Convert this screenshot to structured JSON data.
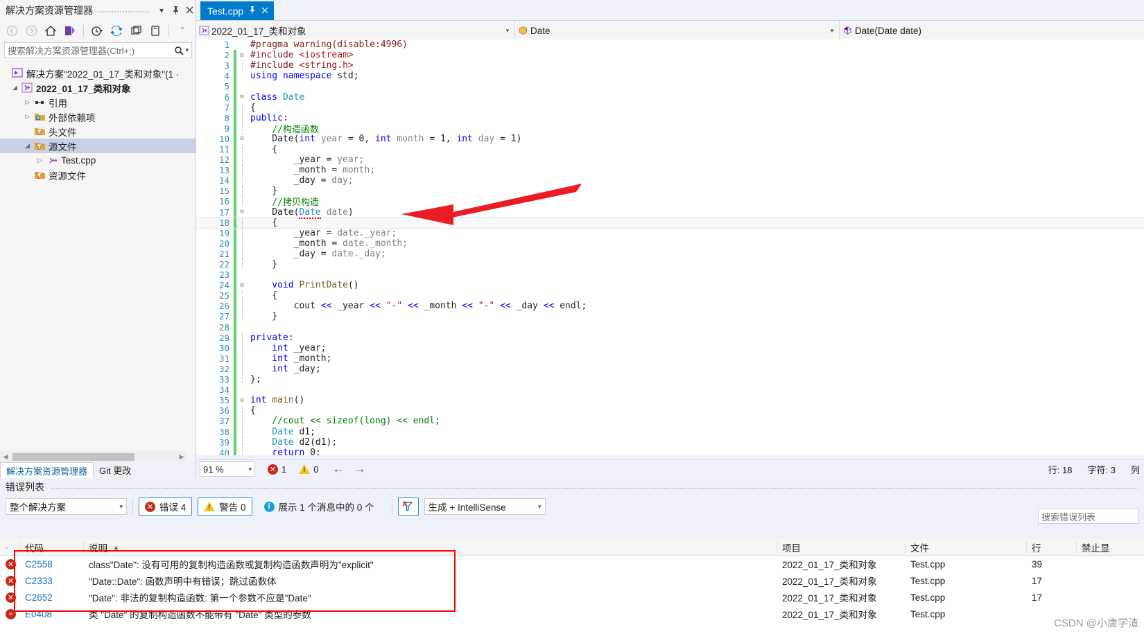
{
  "solution_explorer": {
    "title": "解决方案资源管理器",
    "header_buttons": [
      "chevron-down-icon",
      "pin-icon",
      "close-icon"
    ],
    "toolbar_icons": [
      "back-icon",
      "forward-icon",
      "home-icon",
      "sync-with-active-document-icon",
      "pending-changes-icon",
      "refresh-icon",
      "collapse-all-icon",
      "show-all-files-icon",
      "properties-icon"
    ],
    "search": {
      "placeholder": "搜索解决方案资源管理器(Ctrl+;)"
    },
    "tree": [
      {
        "label": "解决方案\"2022_01_17_类和对象\"(1 ·",
        "icon": "solution-icon",
        "indent": 0,
        "expander": "",
        "bold": false,
        "selected": false
      },
      {
        "label": "2022_01_17_类和对象",
        "icon": "cpp-project-icon",
        "indent": 1,
        "expander": "▲",
        "bold": true,
        "selected": false
      },
      {
        "label": "引用",
        "icon": "references-icon",
        "indent": 2,
        "expander": "▷",
        "bold": false,
        "selected": false
      },
      {
        "label": "外部依赖项",
        "icon": "external-dependencies-icon",
        "indent": 2,
        "expander": "▷",
        "bold": false,
        "selected": false
      },
      {
        "label": "头文件",
        "icon": "filter-folder-icon",
        "indent": 2,
        "expander": "",
        "bold": false,
        "selected": false
      },
      {
        "label": "源文件",
        "icon": "filter-folder-icon",
        "indent": 2,
        "expander": "▲",
        "bold": false,
        "selected": true
      },
      {
        "label": "Test.cpp",
        "icon": "cpp-file-icon",
        "indent": 3,
        "expander": "▷",
        "bold": false,
        "selected": false
      },
      {
        "label": "资源文件",
        "icon": "filter-folder-icon",
        "indent": 2,
        "expander": "",
        "bold": false,
        "selected": false
      }
    ],
    "bottom_tabs": [
      {
        "label": "解决方案资源管理器",
        "active": true
      },
      {
        "label": "Git 更改",
        "active": false
      }
    ]
  },
  "editor": {
    "tab": {
      "label": "Test.cpp",
      "pin": "pin-icon",
      "close": "close-icon"
    },
    "navbar": {
      "project": "2022_01_17_类和对象",
      "type": "Date",
      "member": "Date(Date date)"
    },
    "current_line": 18,
    "lines": [
      {
        "n": 1,
        "changed": false,
        "glyph": "",
        "tokens": [
          {
            "t": "#pragma warning(disable:4996)",
            "c": "pp"
          }
        ]
      },
      {
        "n": 2,
        "changed": true,
        "glyph": "-",
        "tokens": [
          {
            "t": "#include ",
            "c": "pp"
          },
          {
            "t": "<iostream>",
            "c": "str"
          }
        ]
      },
      {
        "n": 3,
        "changed": true,
        "glyph": "|",
        "tokens": [
          {
            "t": "#include ",
            "c": "pp"
          },
          {
            "t": "<string.h>",
            "c": "str"
          }
        ]
      },
      {
        "n": 4,
        "changed": true,
        "glyph": "",
        "tokens": [
          {
            "t": "using namespace ",
            "c": "k"
          },
          {
            "t": "std;",
            "c": "pl"
          }
        ]
      },
      {
        "n": 5,
        "changed": true,
        "glyph": "",
        "tokens": []
      },
      {
        "n": 6,
        "changed": true,
        "glyph": "-",
        "tokens": [
          {
            "t": "class ",
            "c": "k"
          },
          {
            "t": "Date",
            "c": "ty"
          }
        ]
      },
      {
        "n": 7,
        "changed": true,
        "glyph": "|",
        "tokens": [
          {
            "t": "{",
            "c": "pl"
          }
        ]
      },
      {
        "n": 8,
        "changed": true,
        "glyph": "|",
        "tokens": [
          {
            "t": "public",
            "c": "k"
          },
          {
            "t": ":",
            "c": "pl"
          }
        ]
      },
      {
        "n": 9,
        "changed": true,
        "glyph": "|",
        "tokens": [
          {
            "t": "    //构造函数",
            "c": "cm"
          }
        ]
      },
      {
        "n": 10,
        "changed": true,
        "glyph": "-",
        "tokens": [
          {
            "t": "    Date(",
            "c": "pl"
          },
          {
            "t": "int ",
            "c": "k"
          },
          {
            "t": "year",
            "c": "var"
          },
          {
            "t": " = 0, ",
            "c": "pl"
          },
          {
            "t": "int ",
            "c": "k"
          },
          {
            "t": "month",
            "c": "var"
          },
          {
            "t": " = 1, ",
            "c": "pl"
          },
          {
            "t": "int ",
            "c": "k"
          },
          {
            "t": "day",
            "c": "var"
          },
          {
            "t": " = 1)",
            "c": "pl"
          }
        ]
      },
      {
        "n": 11,
        "changed": true,
        "glyph": "|",
        "tokens": [
          {
            "t": "    {",
            "c": "pl"
          }
        ]
      },
      {
        "n": 12,
        "changed": true,
        "glyph": "|",
        "tokens": [
          {
            "t": "        _year = ",
            "c": "pl"
          },
          {
            "t": "year;",
            "c": "var"
          }
        ]
      },
      {
        "n": 13,
        "changed": true,
        "glyph": "|",
        "tokens": [
          {
            "t": "        _month = ",
            "c": "pl"
          },
          {
            "t": "month;",
            "c": "var"
          }
        ]
      },
      {
        "n": 14,
        "changed": true,
        "glyph": "|",
        "tokens": [
          {
            "t": "        _day = ",
            "c": "pl"
          },
          {
            "t": "day;",
            "c": "var"
          }
        ]
      },
      {
        "n": 15,
        "changed": true,
        "glyph": "|",
        "tokens": [
          {
            "t": "    }",
            "c": "pl"
          }
        ]
      },
      {
        "n": 16,
        "changed": true,
        "glyph": "|",
        "tokens": [
          {
            "t": "    //拷贝构造",
            "c": "cm"
          }
        ]
      },
      {
        "n": 17,
        "changed": true,
        "glyph": "-",
        "tokens": [
          {
            "t": "    Date(",
            "c": "pl"
          },
          {
            "t": "Date",
            "c": "ty squig"
          },
          {
            "t": " ",
            "c": "pl"
          },
          {
            "t": "date",
            "c": "var"
          },
          {
            "t": ")",
            "c": "pl"
          }
        ]
      },
      {
        "n": 18,
        "changed": true,
        "glyph": "|",
        "tokens": [
          {
            "t": "    {",
            "c": "pl"
          }
        ]
      },
      {
        "n": 19,
        "changed": true,
        "glyph": "|",
        "tokens": [
          {
            "t": "        _year = ",
            "c": "pl"
          },
          {
            "t": "date._year;",
            "c": "var"
          }
        ]
      },
      {
        "n": 20,
        "changed": true,
        "glyph": "|",
        "tokens": [
          {
            "t": "        _month = ",
            "c": "pl"
          },
          {
            "t": "date._month;",
            "c": "var"
          }
        ]
      },
      {
        "n": 21,
        "changed": true,
        "glyph": "|",
        "tokens": [
          {
            "t": "        _day = ",
            "c": "pl"
          },
          {
            "t": "date._day;",
            "c": "var"
          }
        ]
      },
      {
        "n": 22,
        "changed": true,
        "glyph": "|",
        "tokens": [
          {
            "t": "    }",
            "c": "pl"
          }
        ]
      },
      {
        "n": 23,
        "changed": true,
        "glyph": "",
        "tokens": []
      },
      {
        "n": 24,
        "changed": true,
        "glyph": "-",
        "tokens": [
          {
            "t": "    void ",
            "c": "k"
          },
          {
            "t": "PrintDate",
            "c": "fn"
          },
          {
            "t": "()",
            "c": "pl"
          }
        ]
      },
      {
        "n": 25,
        "changed": true,
        "glyph": "|",
        "tokens": [
          {
            "t": "    {",
            "c": "pl"
          }
        ]
      },
      {
        "n": 26,
        "changed": true,
        "glyph": "|",
        "tokens": [
          {
            "t": "        cout ",
            "c": "pl"
          },
          {
            "t": "<< ",
            "c": "k"
          },
          {
            "t": "_year ",
            "c": "pl"
          },
          {
            "t": "<< ",
            "c": "k"
          },
          {
            "t": "\"-\" ",
            "c": "str"
          },
          {
            "t": "<< ",
            "c": "k"
          },
          {
            "t": "_month ",
            "c": "pl"
          },
          {
            "t": "<< ",
            "c": "k"
          },
          {
            "t": "\"-\" ",
            "c": "str"
          },
          {
            "t": "<< ",
            "c": "k"
          },
          {
            "t": "_day ",
            "c": "pl"
          },
          {
            "t": "<< ",
            "c": "k"
          },
          {
            "t": "endl;",
            "c": "pl"
          }
        ]
      },
      {
        "n": 27,
        "changed": true,
        "glyph": "|",
        "tokens": [
          {
            "t": "    }",
            "c": "pl"
          }
        ]
      },
      {
        "n": 28,
        "changed": true,
        "glyph": "",
        "tokens": []
      },
      {
        "n": 29,
        "changed": true,
        "glyph": "|",
        "tokens": [
          {
            "t": "private",
            "c": "k"
          },
          {
            "t": ":",
            "c": "pl"
          }
        ]
      },
      {
        "n": 30,
        "changed": true,
        "glyph": "|",
        "tokens": [
          {
            "t": "    int ",
            "c": "k"
          },
          {
            "t": "_year;",
            "c": "pl"
          }
        ]
      },
      {
        "n": 31,
        "changed": true,
        "glyph": "|",
        "tokens": [
          {
            "t": "    int ",
            "c": "k"
          },
          {
            "t": "_month;",
            "c": "pl"
          }
        ]
      },
      {
        "n": 32,
        "changed": true,
        "glyph": "|",
        "tokens": [
          {
            "t": "    int ",
            "c": "k"
          },
          {
            "t": "_day;",
            "c": "pl"
          }
        ]
      },
      {
        "n": 33,
        "changed": true,
        "glyph": "|",
        "tokens": [
          {
            "t": "};",
            "c": "pl"
          }
        ]
      },
      {
        "n": 34,
        "changed": true,
        "glyph": "",
        "tokens": []
      },
      {
        "n": 35,
        "changed": true,
        "glyph": "-",
        "tokens": [
          {
            "t": "int ",
            "c": "k"
          },
          {
            "t": "main",
            "c": "fn"
          },
          {
            "t": "()",
            "c": "pl"
          }
        ]
      },
      {
        "n": 36,
        "changed": true,
        "glyph": "|",
        "tokens": [
          {
            "t": "{",
            "c": "pl"
          }
        ]
      },
      {
        "n": 37,
        "changed": true,
        "glyph": "|",
        "tokens": [
          {
            "t": "    //cout << sizeof(long) << endl;",
            "c": "cm"
          }
        ]
      },
      {
        "n": 38,
        "changed": true,
        "glyph": "|",
        "tokens": [
          {
            "t": "    Date",
            "c": "ty"
          },
          {
            "t": " d1;",
            "c": "pl"
          }
        ]
      },
      {
        "n": 39,
        "changed": true,
        "glyph": "|",
        "tokens": [
          {
            "t": "    Date",
            "c": "ty"
          },
          {
            "t": " d2(d1);",
            "c": "pl"
          }
        ]
      },
      {
        "n": 40,
        "changed": true,
        "glyph": "|",
        "tokens": [
          {
            "t": "    return ",
            "c": "k"
          },
          {
            "t": "0;",
            "c": "pl"
          }
        ]
      }
    ],
    "status": {
      "zoom": "91 %",
      "error_count": "1",
      "warning_count": "0",
      "prev_icon": "arrow-left-icon",
      "next_icon": "arrow-right-icon",
      "line_label": "行: 18",
      "char_label": "字符: 3",
      "col_label": "列"
    }
  },
  "error_list": {
    "title": "错误列表",
    "scope": "整个解决方案",
    "filters": [
      {
        "label": "错误 4",
        "icon": "error-icon",
        "active": true
      },
      {
        "label": "警告 0",
        "icon": "warning-icon",
        "active": true
      },
      {
        "label": "展示 1 个消息中的 0 个",
        "icon": "info-icon",
        "active": false
      }
    ],
    "clear_filter_icon": "clear-filter-icon",
    "build_source": "生成 + IntelliSense",
    "search": {
      "placeholder": "搜索错误列表"
    },
    "columns": [
      "",
      "代码",
      "说明",
      "项目",
      "文件",
      "行",
      "禁止显"
    ],
    "sort_column": "说明",
    "rows": [
      {
        "icon": "error-icon",
        "code": "C2558",
        "desc": "class\"Date\": 没有可用的复制构造函数或复制构造函数声明为\"explicit\"",
        "project": "2022_01_17_类和对象",
        "file": "Test.cpp",
        "line": "39"
      },
      {
        "icon": "error-icon",
        "code": "C2333",
        "desc": "\"Date::Date\": 函数声明中有错误；跳过函数体",
        "project": "2022_01_17_类和对象",
        "file": "Test.cpp",
        "line": "17"
      },
      {
        "icon": "error-icon",
        "code": "C2652",
        "desc": "\"Date\": 非法的复制构造函数: 第一个参数不应是\"Date\"",
        "project": "2022_01_17_类和对象",
        "file": "Test.cpp",
        "line": "17"
      },
      {
        "icon": "intellisense-error-icon",
        "code": "E0408",
        "desc": "类 \"Date\" 的复制构造函数不能带有 \"Date\" 类型的参数",
        "project": "2022_01_17_类和对象",
        "file": "Test.cpp",
        "line": ""
      }
    ]
  },
  "watermark": "CSDN @小唐学渣",
  "colors": {
    "accent": "#007acc",
    "error": "#c42b1c",
    "warning": "#f0c419",
    "info": "#1a9ed9",
    "annotation_red": "#ff0000",
    "changed_green": "#62d06c"
  }
}
